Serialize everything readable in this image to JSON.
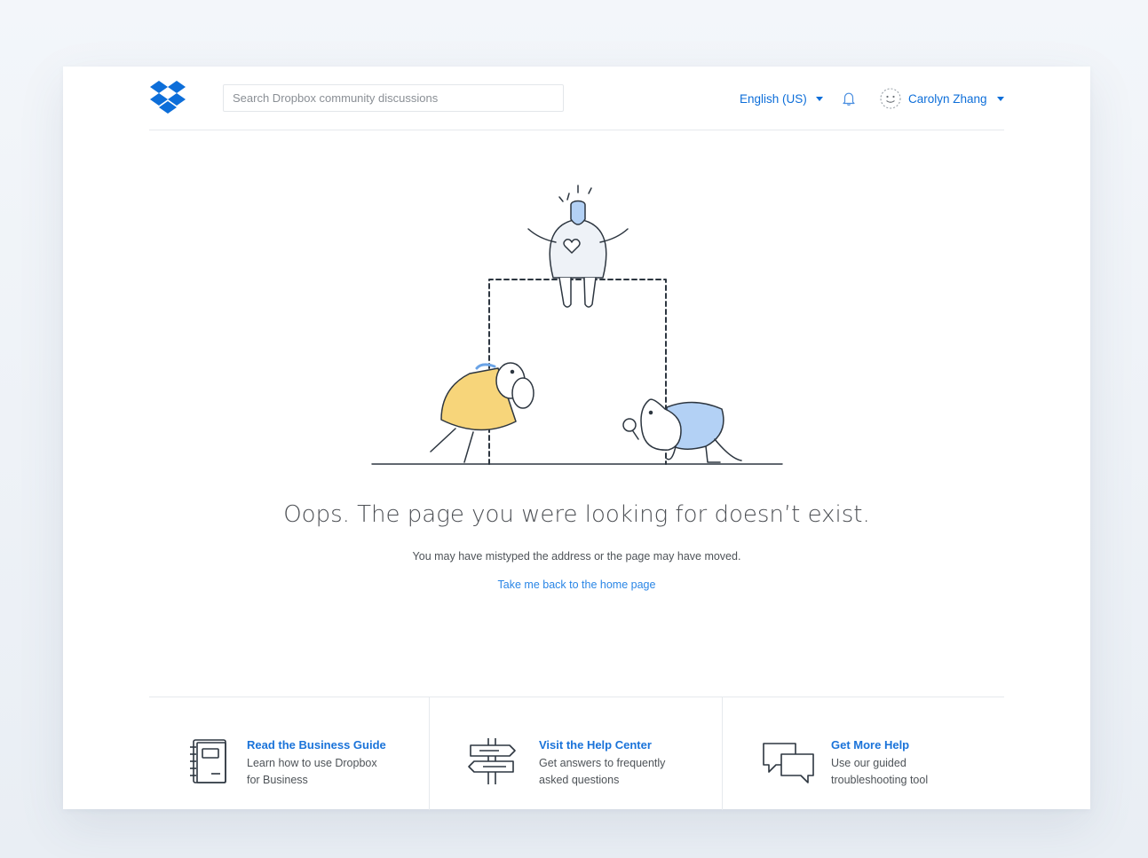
{
  "header": {
    "search_placeholder": "Search Dropbox community discussions",
    "language": "English (US)",
    "user_name": "Carolyn Zhang"
  },
  "main": {
    "title": "Oops. The page you were looking for doesn’t exist.",
    "subtitle": "You may have mistyped the address or the page may have moved.",
    "home_link": "Take me back to the home page"
  },
  "footer": {
    "items": [
      {
        "title": "Read the Business Guide",
        "line1": "Learn how to use Dropbox",
        "line2": "for Business",
        "icon": "notebook-icon"
      },
      {
        "title": "Visit the Help Center",
        "line1": "Get answers to frequently",
        "line2": "asked questions",
        "icon": "signpost-icon"
      },
      {
        "title": "Get More Help",
        "line1": "Use our guided",
        "line2": "troubleshooting tool",
        "icon": "chat-bubbles-icon"
      }
    ]
  },
  "colors": {
    "brand_blue": "#0d6ed9",
    "link_blue": "#2a86e6",
    "illustration_yellow": "#f7d57a",
    "illustration_light_blue": "#b3d1f5"
  }
}
